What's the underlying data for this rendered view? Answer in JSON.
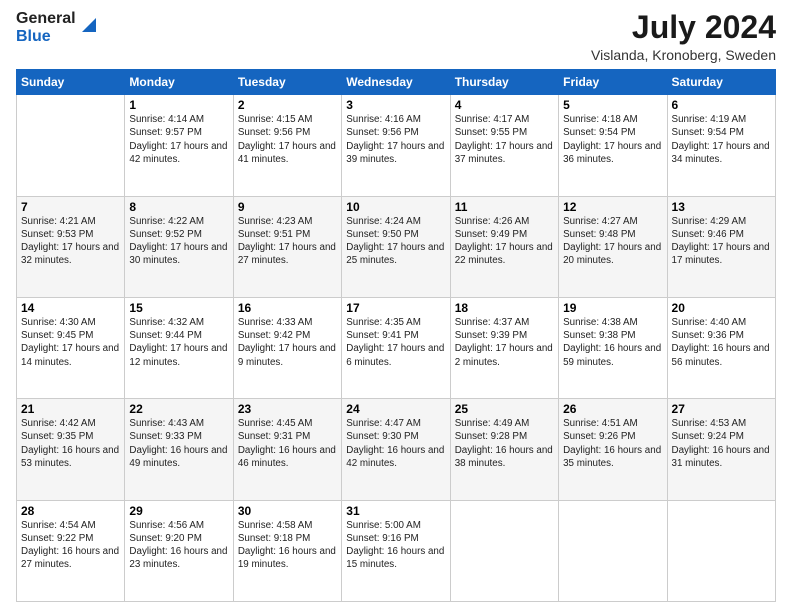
{
  "header": {
    "logo_line1": "General",
    "logo_line2": "Blue",
    "main_title": "July 2024",
    "subtitle": "Vislanda, Kronoberg, Sweden"
  },
  "columns": [
    "Sunday",
    "Monday",
    "Tuesday",
    "Wednesday",
    "Thursday",
    "Friday",
    "Saturday"
  ],
  "weeks": [
    [
      {
        "day": "",
        "sunrise": "",
        "sunset": "",
        "daylight": ""
      },
      {
        "day": "1",
        "sunrise": "Sunrise: 4:14 AM",
        "sunset": "Sunset: 9:57 PM",
        "daylight": "Daylight: 17 hours and 42 minutes."
      },
      {
        "day": "2",
        "sunrise": "Sunrise: 4:15 AM",
        "sunset": "Sunset: 9:56 PM",
        "daylight": "Daylight: 17 hours and 41 minutes."
      },
      {
        "day": "3",
        "sunrise": "Sunrise: 4:16 AM",
        "sunset": "Sunset: 9:56 PM",
        "daylight": "Daylight: 17 hours and 39 minutes."
      },
      {
        "day": "4",
        "sunrise": "Sunrise: 4:17 AM",
        "sunset": "Sunset: 9:55 PM",
        "daylight": "Daylight: 17 hours and 37 minutes."
      },
      {
        "day": "5",
        "sunrise": "Sunrise: 4:18 AM",
        "sunset": "Sunset: 9:54 PM",
        "daylight": "Daylight: 17 hours and 36 minutes."
      },
      {
        "day": "6",
        "sunrise": "Sunrise: 4:19 AM",
        "sunset": "Sunset: 9:54 PM",
        "daylight": "Daylight: 17 hours and 34 minutes."
      }
    ],
    [
      {
        "day": "7",
        "sunrise": "Sunrise: 4:21 AM",
        "sunset": "Sunset: 9:53 PM",
        "daylight": "Daylight: 17 hours and 32 minutes."
      },
      {
        "day": "8",
        "sunrise": "Sunrise: 4:22 AM",
        "sunset": "Sunset: 9:52 PM",
        "daylight": "Daylight: 17 hours and 30 minutes."
      },
      {
        "day": "9",
        "sunrise": "Sunrise: 4:23 AM",
        "sunset": "Sunset: 9:51 PM",
        "daylight": "Daylight: 17 hours and 27 minutes."
      },
      {
        "day": "10",
        "sunrise": "Sunrise: 4:24 AM",
        "sunset": "Sunset: 9:50 PM",
        "daylight": "Daylight: 17 hours and 25 minutes."
      },
      {
        "day": "11",
        "sunrise": "Sunrise: 4:26 AM",
        "sunset": "Sunset: 9:49 PM",
        "daylight": "Daylight: 17 hours and 22 minutes."
      },
      {
        "day": "12",
        "sunrise": "Sunrise: 4:27 AM",
        "sunset": "Sunset: 9:48 PM",
        "daylight": "Daylight: 17 hours and 20 minutes."
      },
      {
        "day": "13",
        "sunrise": "Sunrise: 4:29 AM",
        "sunset": "Sunset: 9:46 PM",
        "daylight": "Daylight: 17 hours and 17 minutes."
      }
    ],
    [
      {
        "day": "14",
        "sunrise": "Sunrise: 4:30 AM",
        "sunset": "Sunset: 9:45 PM",
        "daylight": "Daylight: 17 hours and 14 minutes."
      },
      {
        "day": "15",
        "sunrise": "Sunrise: 4:32 AM",
        "sunset": "Sunset: 9:44 PM",
        "daylight": "Daylight: 17 hours and 12 minutes."
      },
      {
        "day": "16",
        "sunrise": "Sunrise: 4:33 AM",
        "sunset": "Sunset: 9:42 PM",
        "daylight": "Daylight: 17 hours and 9 minutes."
      },
      {
        "day": "17",
        "sunrise": "Sunrise: 4:35 AM",
        "sunset": "Sunset: 9:41 PM",
        "daylight": "Daylight: 17 hours and 6 minutes."
      },
      {
        "day": "18",
        "sunrise": "Sunrise: 4:37 AM",
        "sunset": "Sunset: 9:39 PM",
        "daylight": "Daylight: 17 hours and 2 minutes."
      },
      {
        "day": "19",
        "sunrise": "Sunrise: 4:38 AM",
        "sunset": "Sunset: 9:38 PM",
        "daylight": "Daylight: 16 hours and 59 minutes."
      },
      {
        "day": "20",
        "sunrise": "Sunrise: 4:40 AM",
        "sunset": "Sunset: 9:36 PM",
        "daylight": "Daylight: 16 hours and 56 minutes."
      }
    ],
    [
      {
        "day": "21",
        "sunrise": "Sunrise: 4:42 AM",
        "sunset": "Sunset: 9:35 PM",
        "daylight": "Daylight: 16 hours and 53 minutes."
      },
      {
        "day": "22",
        "sunrise": "Sunrise: 4:43 AM",
        "sunset": "Sunset: 9:33 PM",
        "daylight": "Daylight: 16 hours and 49 minutes."
      },
      {
        "day": "23",
        "sunrise": "Sunrise: 4:45 AM",
        "sunset": "Sunset: 9:31 PM",
        "daylight": "Daylight: 16 hours and 46 minutes."
      },
      {
        "day": "24",
        "sunrise": "Sunrise: 4:47 AM",
        "sunset": "Sunset: 9:30 PM",
        "daylight": "Daylight: 16 hours and 42 minutes."
      },
      {
        "day": "25",
        "sunrise": "Sunrise: 4:49 AM",
        "sunset": "Sunset: 9:28 PM",
        "daylight": "Daylight: 16 hours and 38 minutes."
      },
      {
        "day": "26",
        "sunrise": "Sunrise: 4:51 AM",
        "sunset": "Sunset: 9:26 PM",
        "daylight": "Daylight: 16 hours and 35 minutes."
      },
      {
        "day": "27",
        "sunrise": "Sunrise: 4:53 AM",
        "sunset": "Sunset: 9:24 PM",
        "daylight": "Daylight: 16 hours and 31 minutes."
      }
    ],
    [
      {
        "day": "28",
        "sunrise": "Sunrise: 4:54 AM",
        "sunset": "Sunset: 9:22 PM",
        "daylight": "Daylight: 16 hours and 27 minutes."
      },
      {
        "day": "29",
        "sunrise": "Sunrise: 4:56 AM",
        "sunset": "Sunset: 9:20 PM",
        "daylight": "Daylight: 16 hours and 23 minutes."
      },
      {
        "day": "30",
        "sunrise": "Sunrise: 4:58 AM",
        "sunset": "Sunset: 9:18 PM",
        "daylight": "Daylight: 16 hours and 19 minutes."
      },
      {
        "day": "31",
        "sunrise": "Sunrise: 5:00 AM",
        "sunset": "Sunset: 9:16 PM",
        "daylight": "Daylight: 16 hours and 15 minutes."
      },
      {
        "day": "",
        "sunrise": "",
        "sunset": "",
        "daylight": ""
      },
      {
        "day": "",
        "sunrise": "",
        "sunset": "",
        "daylight": ""
      },
      {
        "day": "",
        "sunrise": "",
        "sunset": "",
        "daylight": ""
      }
    ]
  ]
}
